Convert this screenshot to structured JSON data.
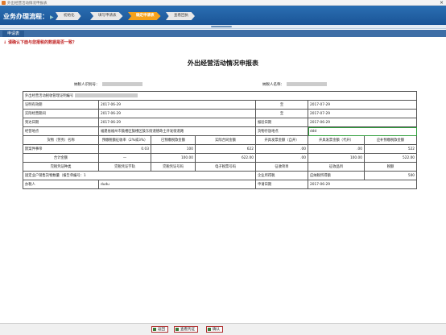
{
  "window": {
    "title": "外出经营活动情况申报表"
  },
  "process": {
    "title": "业务办理流程：",
    "steps": [
      "初始化",
      "填写申请表",
      "确定申请表",
      "查看回执"
    ]
  },
  "tab": {
    "label": "申请表"
  },
  "confirm_text": "请确认下面与您报税的数据是否一致？",
  "form": {
    "title": "外出经营活动情况申报表",
    "taxpayer_id_label": "纳税人识别号：",
    "taxpayer_name_label": "纳税人名称："
  },
  "rows": {
    "cert_label": "外出经营活动税收管理证明编号",
    "period_label": "证明有效期",
    "period_from": "2017-06-29",
    "period_to": "2017-07-29",
    "to_label": "至",
    "actual_label": "实际经营期间",
    "actual_from": "2017-06-29",
    "actual_to": "2017-07-29",
    "arrive_label": "到达日期",
    "arrive_date": "2017-06-29",
    "report_label": "报验日期",
    "report_date": "2017-06-29",
    "place_label": "经营地点",
    "place_value": "福建省福州市鼓楼区鼓楼区鼓东街道德政士开发街道路",
    "storage_label": "货物存放地点",
    "storage_value": "ddd",
    "goods_header": [
      "货物（劳务）名称",
      "预缴税额征收率（2%或3%）",
      "已预缴税款金额",
      "实际合同金额",
      "开具发票金额（自开）",
      "开具发票金额（代开）",
      "应补预缴税款金额"
    ],
    "goods_name": "鹊案件事帝",
    "goods_values": [
      "0.03",
      "100",
      "622",
      ".00",
      ".00",
      "522"
    ],
    "total_label": "合计金额",
    "total_values": [
      "—",
      "100.00",
      "622.00",
      ".00",
      "100.00",
      "522.00"
    ],
    "voucher_header": [
      "完税凭证种类",
      "完税凭证字轨",
      "完税凭证号码",
      "电子税票号码",
      "征收项目",
      "征收品目",
      "税额"
    ],
    "fixed_label": "固定业户销售货物数量（报告单编号：1",
    "fixed_tax_label": "企业所得税",
    "fixed_return_label": "应纳税所得额",
    "fixed_amount": "500",
    "operator_label": "办税人",
    "operator_value": "dudu",
    "apply_label": "申请日期",
    "apply_date": "2017-06-29"
  },
  "buttons": {
    "back": "返回",
    "view": "查看凭证",
    "ok": "确认"
  }
}
